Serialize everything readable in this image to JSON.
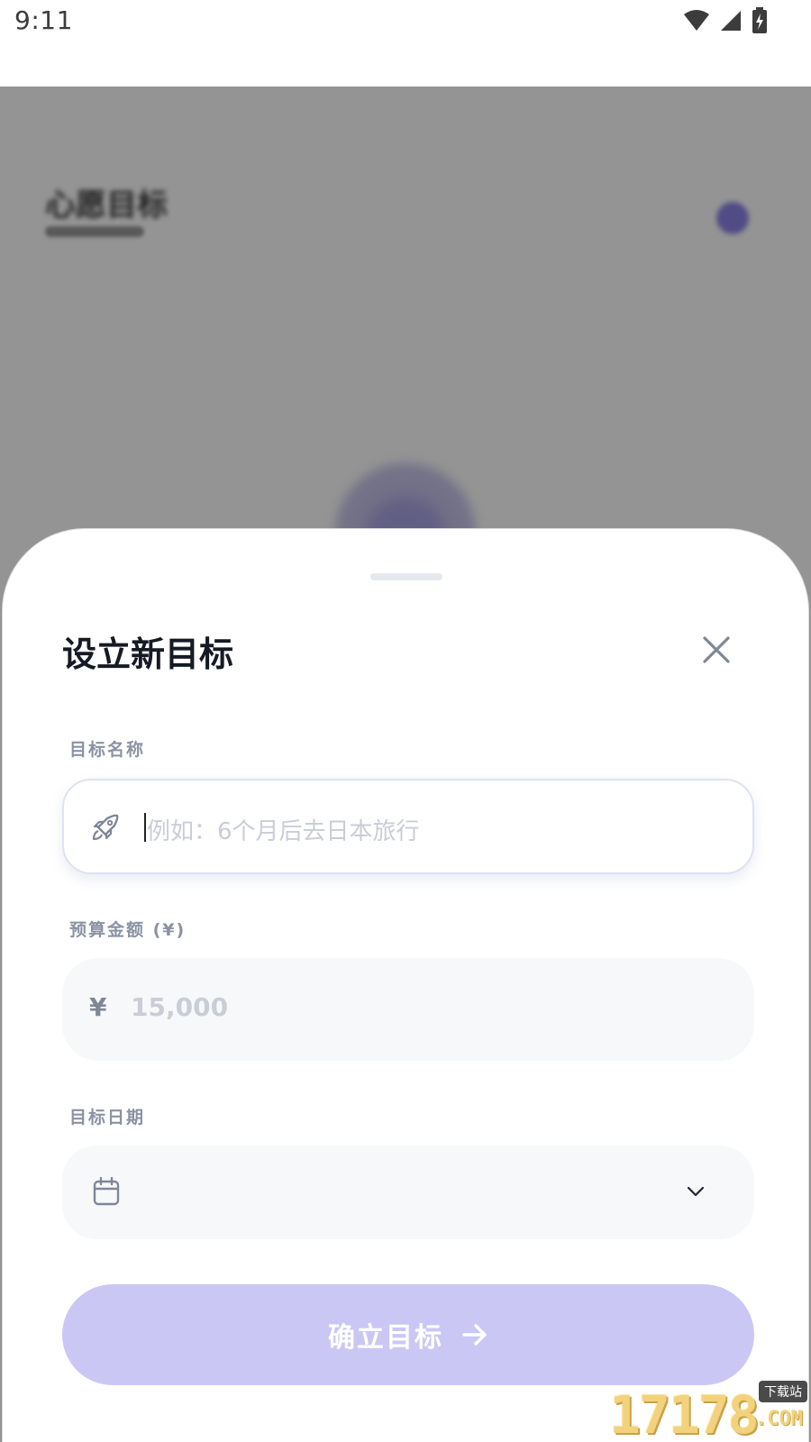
{
  "status_bar": {
    "time": "9:11",
    "icons": [
      "wifi-icon",
      "cell-signal-icon",
      "battery-charging-icon"
    ]
  },
  "background_app": {
    "title": "心愿目标"
  },
  "sheet": {
    "title": "设立新目标",
    "close_icon": "close-icon",
    "fields": {
      "name": {
        "label": "目标名称",
        "placeholder": "例如：6个月后去日本旅行",
        "value": "",
        "icon": "rocket-icon"
      },
      "budget": {
        "label": "预算金额 (¥)",
        "currency_symbol": "¥",
        "placeholder": "15,000",
        "value": ""
      },
      "date": {
        "label": "目标日期",
        "value": "",
        "icon": "calendar-icon",
        "dropdown_icon": "chevron-down-icon"
      }
    },
    "confirm_button": {
      "label": "确立目标",
      "icon": "arrow-right-icon"
    }
  },
  "watermark": {
    "text": "17178",
    "tag": "下载站",
    "suffix": ".COM"
  },
  "colors": {
    "accent_disabled": "#cbc7f5",
    "title": "#151a24",
    "label": "#8a92a3",
    "placeholder": "#c9cdd6",
    "field_bg": "#f7f8fa"
  }
}
